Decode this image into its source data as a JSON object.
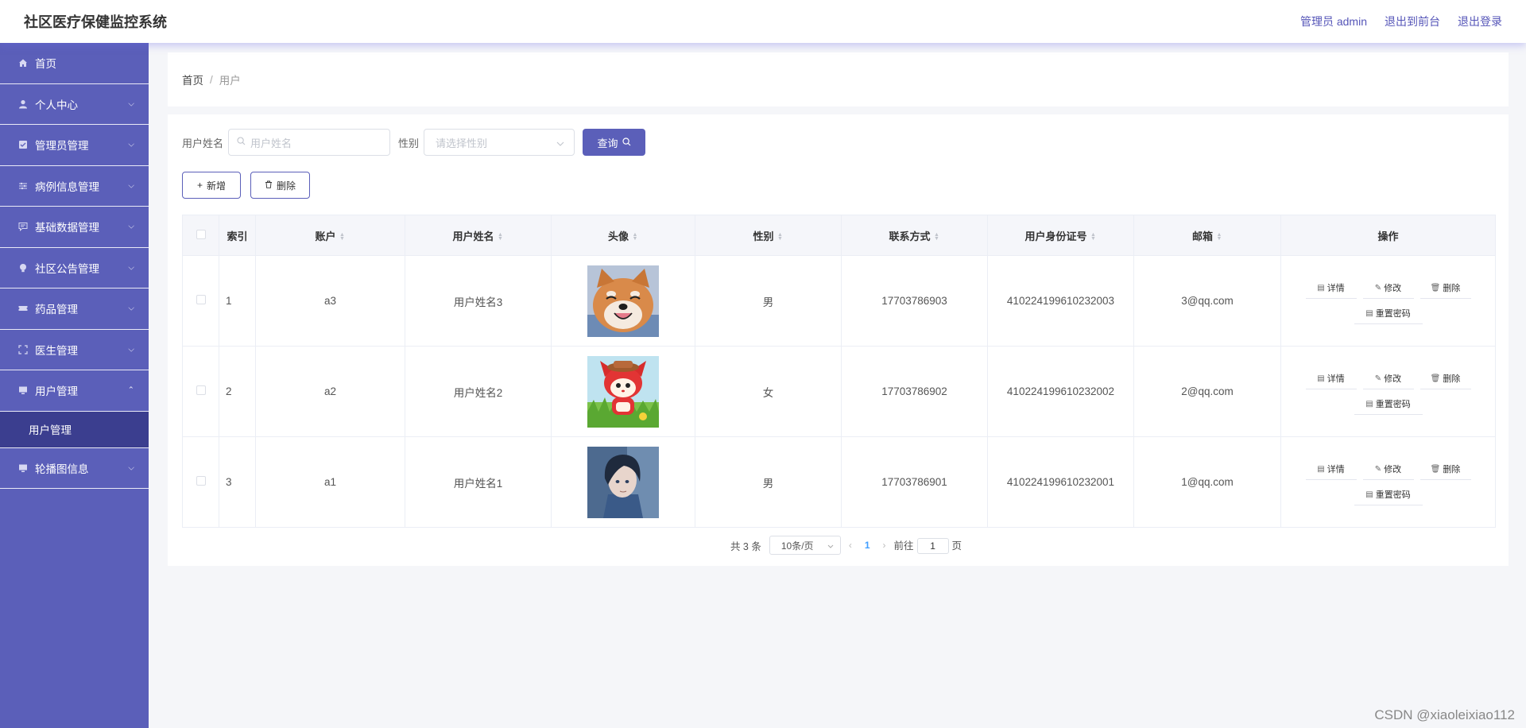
{
  "header": {
    "title": "社区医疗保健监控系统",
    "admin_label": "管理员 admin",
    "front_label": "退出到前台",
    "logout_label": "退出登录"
  },
  "sidebar": {
    "items": [
      {
        "label": "首页",
        "icon": "home-icon",
        "expandable": false
      },
      {
        "label": "个人中心",
        "icon": "user-icon",
        "expandable": true
      },
      {
        "label": "管理员管理",
        "icon": "shield-icon",
        "expandable": true
      },
      {
        "label": "病例信息管理",
        "icon": "sliders-icon",
        "expandable": true
      },
      {
        "label": "基础数据管理",
        "icon": "chat-icon",
        "expandable": true
      },
      {
        "label": "社区公告管理",
        "icon": "bulb-icon",
        "expandable": true
      },
      {
        "label": "药品管理",
        "icon": "ticket-icon",
        "expandable": true
      },
      {
        "label": "医生管理",
        "icon": "frame-icon",
        "expandable": true
      },
      {
        "label": "用户管理",
        "icon": "monitor-icon",
        "expandable": true,
        "expanded": true
      }
    ],
    "sub_item": "用户管理",
    "last_item": {
      "label": "轮播图信息",
      "icon": "monitor-icon"
    }
  },
  "breadcrumb": {
    "home": "首页",
    "current": "用户"
  },
  "search": {
    "name_label": "用户姓名",
    "name_placeholder": "用户姓名",
    "gender_label": "性别",
    "gender_placeholder": "请选择性别",
    "query_label": "查询"
  },
  "actions": {
    "add_label": "新增",
    "delete_label": "删除"
  },
  "table": {
    "headers": [
      "索引",
      "账户",
      "用户姓名",
      "头像",
      "性别",
      "联系方式",
      "用户身份证号",
      "邮箱",
      "操作"
    ],
    "rows": [
      {
        "index": "1",
        "account": "a3",
        "name": "用户姓名3",
        "avatar": "shiba-dog-photo",
        "gender": "男",
        "phone": "17703786903",
        "id_card": "410224199610232003",
        "email": "3@qq.com"
      },
      {
        "index": "2",
        "account": "a2",
        "name": "用户姓名2",
        "avatar": "cartoon-fox-character",
        "gender": "女",
        "phone": "17703786902",
        "id_card": "410224199610232002",
        "email": "2@qq.com"
      },
      {
        "index": "3",
        "account": "a1",
        "name": "用户姓名1",
        "avatar": "anime-boy-portrait",
        "gender": "男",
        "phone": "17703786901",
        "id_card": "410224199610232001",
        "email": "1@qq.com"
      }
    ],
    "ops": {
      "detail": "详情",
      "edit": "修改",
      "delete": "删除",
      "reset": "重置密码"
    }
  },
  "pagination": {
    "total_text": "共 3 条",
    "page_size": "10条/页",
    "current_page": "1",
    "goto_prefix": "前往",
    "goto_value": "1",
    "goto_suffix": "页"
  },
  "watermark": "CSDN @xiaoleixiao112",
  "colors": {
    "accent": "#5b5fb9",
    "sidebar_active": "#3b3e8f"
  }
}
